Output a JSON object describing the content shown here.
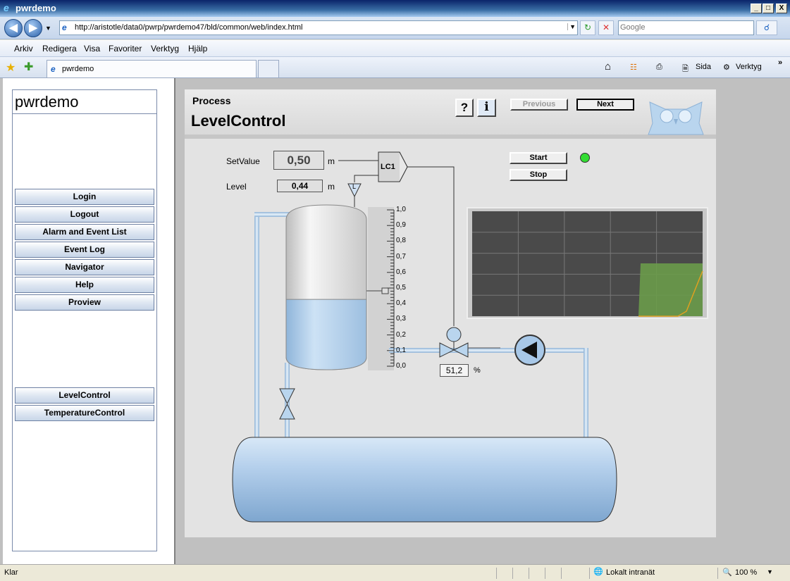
{
  "window": {
    "title": "pwrdemo",
    "minimize": "_",
    "maximize": "□",
    "close": "X"
  },
  "address": {
    "url": "http://aristotle/data0/pwrp/pwrdemo47/bld/common/web/index.html",
    "search_placeholder": "Google"
  },
  "menu": [
    "Arkiv",
    "Redigera",
    "Visa",
    "Favoriter",
    "Verktyg",
    "Hjälp"
  ],
  "tab": {
    "label": "pwrdemo"
  },
  "toolbar": {
    "page": "Sida",
    "tools": "Verktyg"
  },
  "sidebar": {
    "title": "pwrdemo",
    "items": [
      "Login",
      "Logout",
      "Alarm and Event List",
      "Event Log",
      "Navigator",
      "Help",
      "Proview"
    ],
    "apps": [
      "LevelControl",
      "TemperatureControl"
    ]
  },
  "graph": {
    "section": "Process",
    "title": "LevelControl",
    "help": "?",
    "info": "i",
    "prev": "Previous",
    "next": "Next",
    "setvalue_label": "SetValue",
    "setvalue": "0,50",
    "setvalue_unit": "m",
    "level_label": "Level",
    "level": "0,44",
    "level_unit": "m",
    "controller": "LC1",
    "sensor": "L",
    "start": "Start",
    "stop": "Stop",
    "valve_value": "51,2",
    "valve_unit": "%",
    "scale": [
      "1,0",
      "0,9",
      "0,8",
      "0,7",
      "0,6",
      "0,5",
      "0,4",
      "0,3",
      "0,2",
      "0,1",
      "0,0"
    ],
    "tank_fill": 0.44,
    "indicator_color": "#33dd33"
  },
  "status": {
    "left": "Klar",
    "zone": "Lokalt intranät",
    "zoom": "100 %"
  }
}
